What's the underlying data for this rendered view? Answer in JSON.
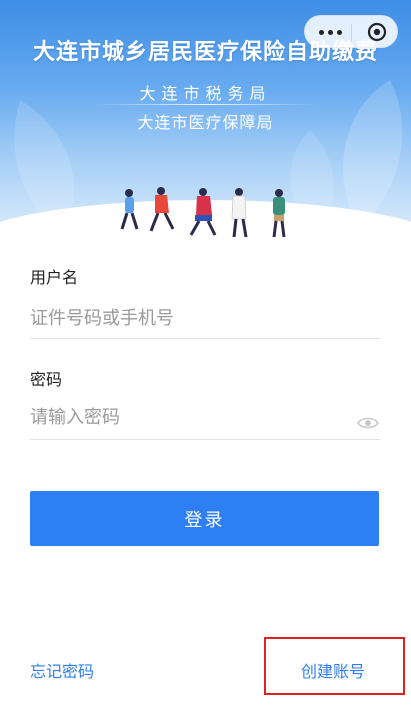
{
  "header": {
    "title": "大连市城乡居民医疗保险自助缴费",
    "subtitle_tax": "大连市税务局",
    "subtitle_medical": "大连市医疗保障局"
  },
  "capsule": {
    "more_icon": "more-dots-icon",
    "close_icon": "target-close-icon"
  },
  "form": {
    "username_label": "用户名",
    "username_placeholder": "证件号码或手机号",
    "password_label": "密码",
    "password_placeholder": "请输入密码",
    "visibility_icon": "eye-icon"
  },
  "actions": {
    "login_label": "登录",
    "forgot_password_label": "忘记密码",
    "create_account_label": "创建账号"
  },
  "colors": {
    "accent": "#2e7ff3",
    "banner_top": "#3d8ee6",
    "highlight": "#e02020"
  }
}
